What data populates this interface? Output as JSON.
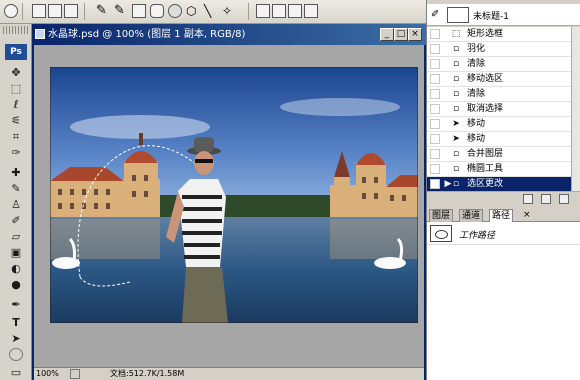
{
  "options_bar": {
    "icons": [
      "ellipse-marquee-icon",
      "new-selection-icon",
      "add-selection-icon",
      "rectangle-shape-icon",
      "rounded-rect-icon",
      "ellipse-shape-icon",
      "polygon-icon",
      "line-icon",
      "custom-shape-icon",
      "combine-icon"
    ]
  },
  "toolbox": {
    "logo": "Ps",
    "tools": [
      "move-tool-icon",
      "marquee-tool-icon",
      "lasso-tool-icon",
      "magic-wand-icon",
      "crop-tool-icon",
      "slice-tool-icon",
      "healing-brush-icon",
      "brush-tool-icon",
      "clone-stamp-icon",
      "history-brush-icon",
      "eraser-tool-icon",
      "gradient-tool-icon",
      "blur-tool-icon",
      "dodge-tool-icon",
      "pen-tool-icon",
      "type-tool-icon",
      "path-select-icon",
      "ellipse-tool-icon",
      "notes-icon"
    ]
  },
  "document": {
    "title": "水晶球.psd @ 100% (图层 1 副本, RGB/8)",
    "zoom": "100%",
    "doc_info": "文档:512.7K/1.58M"
  },
  "history_panel": {
    "snapshot_label": "未标题-1",
    "items": [
      {
        "label": "矩形选框",
        "icon": "rect-marquee-icon",
        "selected": false
      },
      {
        "label": "羽化",
        "icon": "feather-icon",
        "selected": false
      },
      {
        "label": "清除",
        "icon": "clear-icon",
        "selected": false
      },
      {
        "label": "移动选区",
        "icon": "move-selection-icon",
        "selected": false
      },
      {
        "label": "清除",
        "icon": "clear-icon",
        "selected": false
      },
      {
        "label": "取消选择",
        "icon": "deselect-icon",
        "selected": false
      },
      {
        "label": "移动",
        "icon": "move-icon",
        "selected": false
      },
      {
        "label": "移动",
        "icon": "move-icon",
        "selected": false
      },
      {
        "label": "合并图层",
        "icon": "merge-layers-icon",
        "selected": false
      },
      {
        "label": "椭圆工具",
        "icon": "ellipse-icon",
        "selected": false
      },
      {
        "label": "选区更改",
        "icon": "selection-change-icon",
        "selected": true
      }
    ]
  },
  "paths_panel": {
    "tabs": [
      {
        "label": "图层",
        "active": false
      },
      {
        "label": "通道",
        "active": false
      },
      {
        "label": "路径",
        "active": true
      }
    ],
    "path_name": "工作路径"
  },
  "colors": {
    "sky_top": "#1f4a96",
    "sky_bottom": "#8fb2de",
    "water": "#2a5a8a",
    "selected_row": "#0a246a",
    "title_bar": "#0a246a"
  }
}
